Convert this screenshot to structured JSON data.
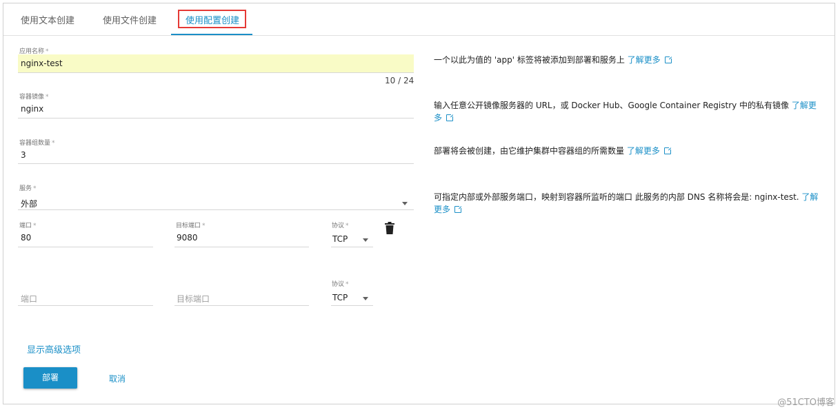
{
  "tabs": [
    {
      "label": "使用文本创建"
    },
    {
      "label": "使用文件创建"
    },
    {
      "label": "使用配置创建",
      "active": true
    }
  ],
  "form": {
    "app_name": {
      "label": "应用名称",
      "required": "*",
      "value": "nginx-test",
      "counter": "10 / 24"
    },
    "image": {
      "label": "容器镜像",
      "required": "*",
      "value": "nginx"
    },
    "pods": {
      "label": "容器组数量",
      "required": "*",
      "value": "3"
    },
    "service": {
      "label": "服务",
      "required": "*",
      "value": "外部"
    },
    "port_rows": [
      {
        "port_label": "端口",
        "port_value": "80",
        "target_label": "目标端口",
        "target_value": "9080",
        "protocol_label": "协议",
        "protocol_value": "TCP",
        "required": "*"
      },
      {
        "port_placeholder": "端口",
        "target_placeholder": "目标端口",
        "protocol_label": "协议",
        "protocol_value": "TCP",
        "required": "*"
      }
    ]
  },
  "help": {
    "app_name": "一个以此为值的 'app' 标签将被添加到部署和服务上",
    "image": "输入任意公开镜像服务器的 URL，或 Docker Hub、Google Container Registry 中的私有镜像",
    "pods": "部署将会被创建，由它维护集群中容器组的所需数量",
    "service": "可指定内部或外部服务端口，映射到容器所监听的端口 此服务的内部 DNS 名称将会是: nginx-test.",
    "learn_more": "了解更多"
  },
  "advanced_link": "显示高级选项",
  "buttons": {
    "deploy": "部署",
    "cancel": "取消"
  },
  "watermark": "@51CTO博客",
  "colors": {
    "accent": "#1a8fc7",
    "highlight_field": "#f9fbc6",
    "tab_highlight_border": "#e53935"
  }
}
